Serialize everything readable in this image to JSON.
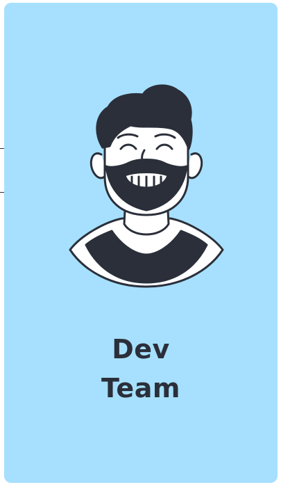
{
  "card": {
    "background": "#a6e0fe",
    "text_color": "#2b2f3a",
    "title_lines": [
      "Dev",
      "Team"
    ]
  },
  "avatar": {
    "icon": "smiling-bearded-man-avatar",
    "ink_color": "#2b2f3a",
    "skin_color": "#ffffff"
  }
}
